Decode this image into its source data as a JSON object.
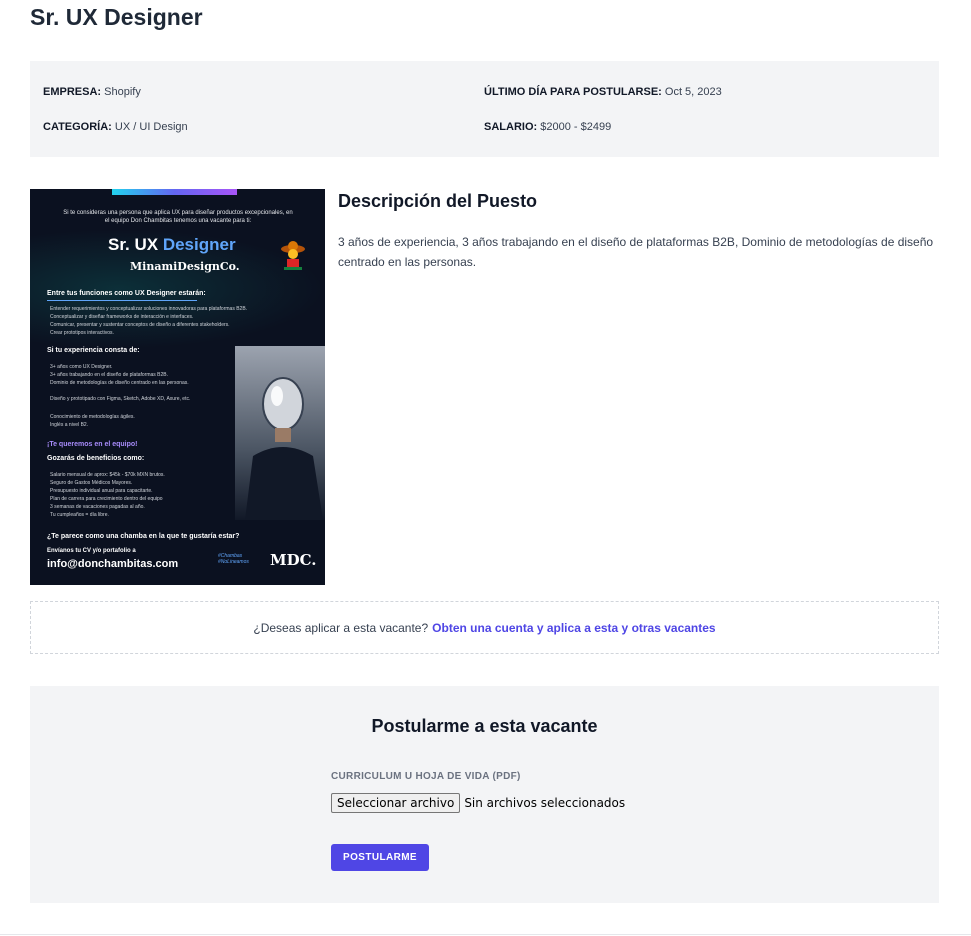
{
  "job": {
    "title": "Sr. UX Designer"
  },
  "meta": {
    "company_label": "EMPRESA:",
    "company_value": "Shopify",
    "deadline_label": "ÚLTIMO DÍA PARA POSTULARSE:",
    "deadline_value": "Oct 5, 2023",
    "category_label": "CATEGORÍA:",
    "category_value": "UX / UI Design",
    "salary_label": "SALARIO:",
    "salary_value": "$2000 - $2499"
  },
  "poster": {
    "intro": "Si te consideras una persona que aplica UX para diseñar productos excepcionales, en el equipo Don Chambitas tenemos una vacante para ti:",
    "heading_sr": "Sr. UX ",
    "heading_designer": "Designer",
    "company": "MinamiDesignCo.",
    "functions_title": "Entre tus funciones como UX Designer estarán:",
    "functions": [
      "Entender requerimientos y conceptualizar soluciones innovadoras para plataformas B2B.",
      "Conceptualizar y diseñar frameworks de interacción e interfaces.",
      "Comunicar, presentar y sustentar conceptos de diseño a diferentes stakeholders.",
      "Crear prototipos interactivos."
    ],
    "experience_title": "Si tu experiencia consta de:",
    "experience": [
      "3+ años como UX Designer.",
      "3+ años trabajando en el diseño de plataformas B2B.",
      "Dominio de metodologías de diseño centrado en las personas.",
      "Diseño y prototipado con Figma, Sketch, Adobe XD, Axure, etc.",
      "Conocimiento de metodologías ágiles.",
      "Inglés a nivel B2."
    ],
    "team_title": "¡Te queremos en el equipo!",
    "benefits_title": "Gozarás de beneficios como:",
    "benefits": [
      "Salario mensual de aprox: $45k - $70k MXN brutos.",
      "Seguro de Gastos Médicos Mayores.",
      "Presupuesto individual anual para capacitarte.",
      "Plan de carrera para crecimiento dentro del equipo",
      "3 semanas de vacaciones pagadas al año.",
      "Tu cumpleaños = día libre."
    ],
    "cta": "¿Te parece como una chamba en la que te gustaría estar?",
    "send": "Envíanos tu CV y/o portafolio a",
    "email": "info@donchambitas.com",
    "brand": "MDC.",
    "hashtag": "#Chambas #NoLineamos"
  },
  "description": {
    "title": "Descripción del Puesto",
    "body": "3 años de experiencia, 3 años trabajando en el diseño de plataformas B2B, Dominio de metodologías de diseño centrado en las personas."
  },
  "apply_prompt": {
    "question": "¿Deseas aplicar a esta vacante?",
    "link": "Obten una cuenta y aplica a esta y otras vacantes"
  },
  "form": {
    "title": "Postularme a esta vacante",
    "file_label": "CURRICULUM U HOJA DE VIDA (PDF)",
    "file_button": "Seleccionar archivo",
    "file_status": "Sin archivos seleccionados",
    "submit": "POSTULARME"
  },
  "colors": {
    "accent": "#4f46e5",
    "panel": "#f3f4f6",
    "poster_bg": "#0b1120",
    "poster_blue": "#60a5fa"
  }
}
